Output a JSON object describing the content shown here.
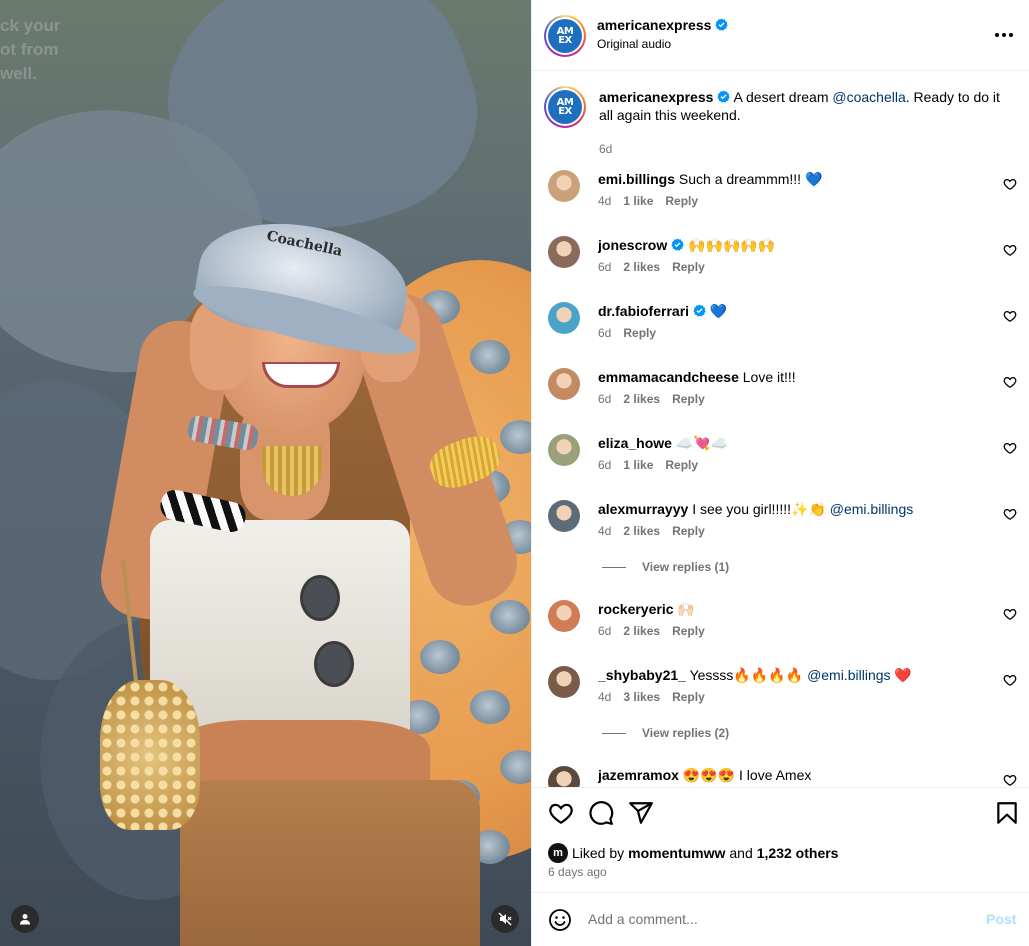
{
  "post": {
    "author": "americanexpress",
    "avatar_text_top": "AM",
    "avatar_text_bottom": "EX",
    "subtitle": "Original audio",
    "caption_text": "A desert dream ",
    "caption_mention": "@coachella",
    "caption_tail": ". Ready to do it all again this weekend.",
    "caption_time": "6d"
  },
  "media": {
    "hat_text": "Coachella",
    "wall_text": [
      "ck your",
      "ot from",
      "well."
    ]
  },
  "comments": [
    {
      "user": "emi.billings",
      "verified": false,
      "text": "Such a dreammm!!! 💙",
      "mention": "",
      "time": "4d",
      "likes": "1 like",
      "reply": "Reply",
      "avatar_color": "#c9a27a"
    },
    {
      "user": "jonescrow",
      "verified": true,
      "text": "🙌🙌🙌🙌🙌",
      "mention": "",
      "time": "6d",
      "likes": "2 likes",
      "reply": "Reply",
      "avatar_color": "#8a6a5a"
    },
    {
      "user": "dr.fabioferrari",
      "verified": true,
      "text": "💙",
      "mention": "",
      "time": "6d",
      "likes": "",
      "reply": "Reply",
      "avatar_color": "#4aa3c8"
    },
    {
      "user": "emmamacandcheese",
      "verified": false,
      "text": "Love it!!!",
      "mention": "",
      "time": "6d",
      "likes": "2 likes",
      "reply": "Reply",
      "avatar_color": "#c48a62"
    },
    {
      "user": "eliza_howe",
      "verified": false,
      "text": "☁️💘☁️",
      "mention": "",
      "time": "6d",
      "likes": "1 like",
      "reply": "Reply",
      "avatar_color": "#9aa07a"
    },
    {
      "user": "alexmurrayyy",
      "verified": false,
      "text": "I see you girl!!!!!✨👏 ",
      "mention": "@emi.billings",
      "time": "4d",
      "likes": "2 likes",
      "reply": "Reply",
      "avatar_color": "#5d6b78"
    },
    {
      "user": "rockeryeric",
      "verified": false,
      "text": "🙌🏻",
      "mention": "",
      "time": "6d",
      "likes": "2 likes",
      "reply": "Reply",
      "avatar_color": "#d07c56"
    },
    {
      "user": "_shybaby21_",
      "verified": false,
      "text": "Yessss🔥🔥🔥🔥 ",
      "mention": "@emi.billings",
      "tail": " ❤️",
      "time": "4d",
      "likes": "3 likes",
      "reply": "Reply",
      "avatar_color": "#7a5a48"
    },
    {
      "user": "jazemramox",
      "verified": false,
      "text": "😍😍😍 I love Amex",
      "mention": "",
      "time": "",
      "likes": "",
      "reply": "",
      "avatar_color": "#5a4a3e"
    }
  ],
  "view_replies": [
    "View replies (1)",
    "View replies (2)"
  ],
  "actions": {
    "liked_by_prefix": "Liked by",
    "liked_by_user": "momentumww",
    "and": "and",
    "others": "1,232 others",
    "liker_badge": "m",
    "date": "6 days ago"
  },
  "add_comment": {
    "placeholder": "Add a comment...",
    "post_label": "Post"
  },
  "colors": {
    "verified": "#0095f6",
    "mention": "#00376b",
    "secondary_text": "#737373",
    "post_disabled": "#b2dffc",
    "amex_blue": "#1f6fbf"
  }
}
